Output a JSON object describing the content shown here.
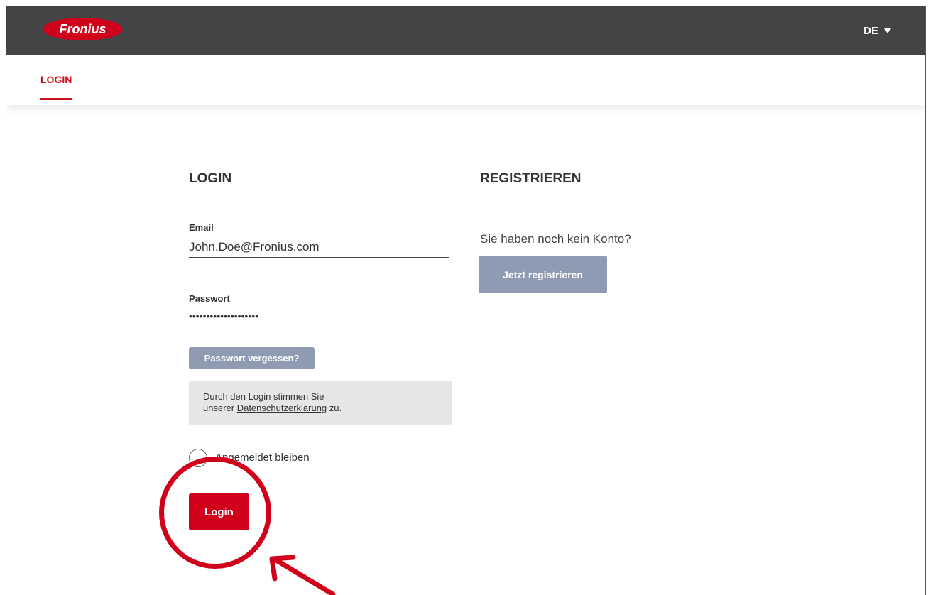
{
  "header": {
    "logo_text": "Fronius",
    "language": "DE",
    "brand_color": "#d0021b",
    "topbar_color": "#444446"
  },
  "tabs": [
    {
      "label": "LOGIN",
      "active": true
    }
  ],
  "login": {
    "title": "LOGIN",
    "email_label": "Email",
    "email_value": "John.Doe@Fronius.com",
    "password_label": "Passwort",
    "password_value": "••••••••••••••••••••",
    "forgot_button": "Passwort vergessen?",
    "notice_line1": "Durch den Login stimmen Sie",
    "notice_prefix": "unserer ",
    "notice_link": "Datenschutzerklärung",
    "notice_suffix": " zu.",
    "remember_label": "Angemeldet bleiben",
    "submit_button": "Login"
  },
  "register": {
    "title": "REGISTRIEREN",
    "question": "Sie haben noch kein Konto?",
    "button": "Jetzt registrieren"
  }
}
